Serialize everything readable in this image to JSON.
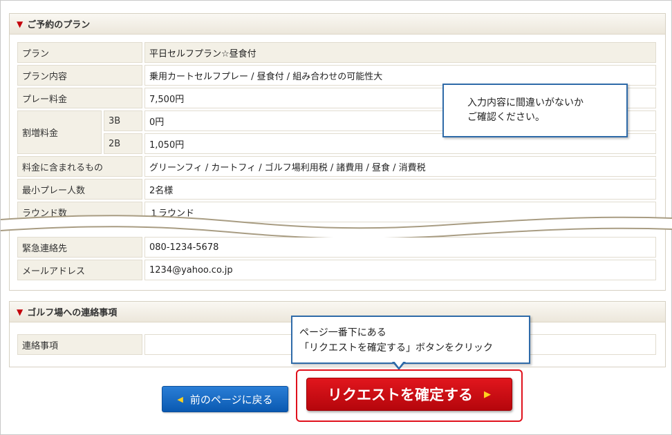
{
  "plan_section": {
    "title": "ご予約のプラン",
    "rows": [
      {
        "label": "プラン",
        "value": "平日セルフプラン☆昼食付"
      },
      {
        "label": "プラン内容",
        "value": "乗用カートセルフプレー / 昼食付 / 組み合わせの可能性大"
      },
      {
        "label": "プレー料金",
        "value": "7,500円"
      },
      {
        "label": "割増料金",
        "sub": [
          {
            "label": "3B",
            "value": "0円"
          },
          {
            "label": "2B",
            "value": "1,050円"
          }
        ]
      },
      {
        "label": "料金に含まれるもの",
        "value": "グリーンフィ / カートフィ / ゴルフ場利用税 / 諸費用 / 昼食 / 消費税"
      },
      {
        "label": "最小プレー人数",
        "value": "2名様"
      },
      {
        "label": "ラウンド数",
        "value": "１ラウンド"
      }
    ],
    "rows_after_break": [
      {
        "label": "緊急連絡先",
        "value": "080-1234-5678"
      },
      {
        "label": "メールアドレス",
        "value": "1234@yahoo.co.jp"
      }
    ]
  },
  "contact_section": {
    "title": "ゴルフ場への連絡事項",
    "rows": [
      {
        "label": "連絡事項",
        "value": ""
      }
    ]
  },
  "callouts": {
    "confirm_line1": "入力内容に間違いがないか",
    "confirm_line2": "ご確認ください。",
    "button_line1": "ページ一番下にある",
    "button_line2": "「リクエストを確定する」ボタンをクリック"
  },
  "buttons": {
    "back": "前のページに戻る",
    "submit": "リクエストを確定する"
  },
  "colors": {
    "accent_red": "#c4000b",
    "accent_blue": "#2e6aa8",
    "label_bg": "#f3f0e6"
  }
}
